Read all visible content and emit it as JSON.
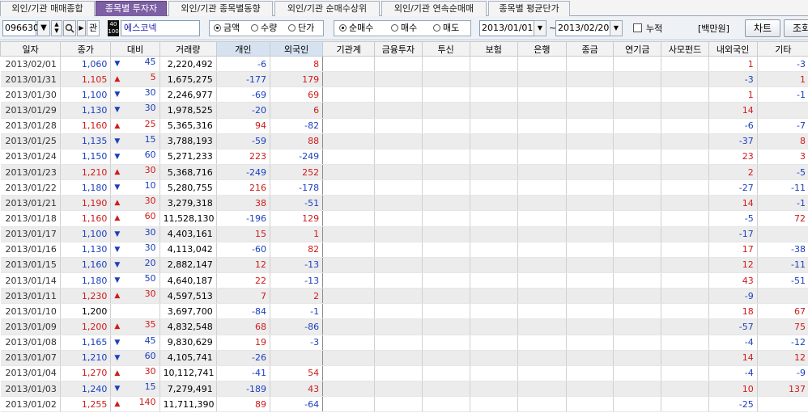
{
  "tabs": [
    {
      "label": "외인/기관 매매종합",
      "active": false
    },
    {
      "label": "종목별 투자자",
      "active": true
    },
    {
      "label": "외인/기관 종목별동향",
      "active": false
    },
    {
      "label": "외인/기관 순매수상위",
      "active": false
    },
    {
      "label": "외인/기관 연속순매매",
      "active": false
    },
    {
      "label": "종목별 평균단가",
      "active": false
    }
  ],
  "toolbar": {
    "stock_code": "096630",
    "kwan_label": "관",
    "logo_text": "40\n100",
    "stock_name": "에스코넥",
    "amount_radio": {
      "options": [
        "금액",
        "수량",
        "단가"
      ],
      "selected": "금액"
    },
    "trade_radio": {
      "options": [
        "순매수",
        "매수",
        "매도"
      ],
      "selected": "순매수"
    },
    "date_from": "2013/01/01",
    "date_to": "2013/02/20",
    "tilde": "~",
    "cumulative_label": "누적",
    "cumulative_checked": false,
    "unit_label": "[백만원]",
    "chart_button": "차트",
    "query_button": "조회"
  },
  "colors": {
    "active_tab": "#7d5fa4",
    "up": "#d11a1a",
    "down": "#1a3fbf",
    "header_highlight": "#d6e2f0"
  },
  "table": {
    "headers": [
      "일자",
      "종가",
      "대비",
      "거래량",
      "개인",
      "외국인",
      "기관계",
      "금융투자",
      "투신",
      "보험",
      "은행",
      "종금",
      "연기금",
      "사모펀드",
      "내외국인",
      "기타"
    ],
    "rows": [
      {
        "date": "2013/02/01",
        "close": "1,060",
        "dir": "down",
        "chg": "45",
        "vol": "2,220,492",
        "ind": "-6",
        "frg": "8",
        "inst": "",
        "fin": "",
        "tr": "",
        "ins": "",
        "bank": "",
        "jong": "",
        "pens": "",
        "pe": "",
        "dom": "1",
        "etc": "-3"
      },
      {
        "date": "2013/01/31",
        "close": "1,105",
        "dir": "up",
        "chg": "5",
        "vol": "1,675,275",
        "ind": "-177",
        "frg": "179",
        "inst": "",
        "fin": "",
        "tr": "",
        "ins": "",
        "bank": "",
        "jong": "",
        "pens": "",
        "pe": "",
        "dom": "-3",
        "etc": "1"
      },
      {
        "date": "2013/01/30",
        "close": "1,100",
        "dir": "down",
        "chg": "30",
        "vol": "2,246,977",
        "ind": "-69",
        "frg": "69",
        "inst": "",
        "fin": "",
        "tr": "",
        "ins": "",
        "bank": "",
        "jong": "",
        "pens": "",
        "pe": "",
        "dom": "1",
        "etc": "-1"
      },
      {
        "date": "2013/01/29",
        "close": "1,130",
        "dir": "down",
        "chg": "30",
        "vol": "1,978,525",
        "ind": "-20",
        "frg": "6",
        "inst": "",
        "fin": "",
        "tr": "",
        "ins": "",
        "bank": "",
        "jong": "",
        "pens": "",
        "pe": "",
        "dom": "14",
        "etc": ""
      },
      {
        "date": "2013/01/28",
        "close": "1,160",
        "dir": "up",
        "chg": "25",
        "vol": "5,365,316",
        "ind": "94",
        "frg": "-82",
        "inst": "",
        "fin": "",
        "tr": "",
        "ins": "",
        "bank": "",
        "jong": "",
        "pens": "",
        "pe": "",
        "dom": "-6",
        "etc": "-7"
      },
      {
        "date": "2013/01/25",
        "close": "1,135",
        "dir": "down",
        "chg": "15",
        "vol": "3,788,193",
        "ind": "-59",
        "frg": "88",
        "inst": "",
        "fin": "",
        "tr": "",
        "ins": "",
        "bank": "",
        "jong": "",
        "pens": "",
        "pe": "",
        "dom": "-37",
        "etc": "8"
      },
      {
        "date": "2013/01/24",
        "close": "1,150",
        "dir": "down",
        "chg": "60",
        "vol": "5,271,233",
        "ind": "223",
        "frg": "-249",
        "inst": "",
        "fin": "",
        "tr": "",
        "ins": "",
        "bank": "",
        "jong": "",
        "pens": "",
        "pe": "",
        "dom": "23",
        "etc": "3"
      },
      {
        "date": "2013/01/23",
        "close": "1,210",
        "dir": "up",
        "chg": "30",
        "vol": "5,368,716",
        "ind": "-249",
        "frg": "252",
        "inst": "",
        "fin": "",
        "tr": "",
        "ins": "",
        "bank": "",
        "jong": "",
        "pens": "",
        "pe": "",
        "dom": "2",
        "etc": "-5"
      },
      {
        "date": "2013/01/22",
        "close": "1,180",
        "dir": "down",
        "chg": "10",
        "vol": "5,280,755",
        "ind": "216",
        "frg": "-178",
        "inst": "",
        "fin": "",
        "tr": "",
        "ins": "",
        "bank": "",
        "jong": "",
        "pens": "",
        "pe": "",
        "dom": "-27",
        "etc": "-11"
      },
      {
        "date": "2013/01/21",
        "close": "1,190",
        "dir": "up",
        "chg": "30",
        "vol": "3,279,318",
        "ind": "38",
        "frg": "-51",
        "inst": "",
        "fin": "",
        "tr": "",
        "ins": "",
        "bank": "",
        "jong": "",
        "pens": "",
        "pe": "",
        "dom": "14",
        "etc": "-1"
      },
      {
        "date": "2013/01/18",
        "close": "1,160",
        "dir": "up",
        "chg": "60",
        "vol": "11,528,130",
        "ind": "-196",
        "frg": "129",
        "inst": "",
        "fin": "",
        "tr": "",
        "ins": "",
        "bank": "",
        "jong": "",
        "pens": "",
        "pe": "",
        "dom": "-5",
        "etc": "72"
      },
      {
        "date": "2013/01/17",
        "close": "1,100",
        "dir": "down",
        "chg": "30",
        "vol": "4,403,161",
        "ind": "15",
        "frg": "1",
        "inst": "",
        "fin": "",
        "tr": "",
        "ins": "",
        "bank": "",
        "jong": "",
        "pens": "",
        "pe": "",
        "dom": "-17",
        "etc": ""
      },
      {
        "date": "2013/01/16",
        "close": "1,130",
        "dir": "down",
        "chg": "30",
        "vol": "4,113,042",
        "ind": "-60",
        "frg": "82",
        "inst": "",
        "fin": "",
        "tr": "",
        "ins": "",
        "bank": "",
        "jong": "",
        "pens": "",
        "pe": "",
        "dom": "17",
        "etc": "-38"
      },
      {
        "date": "2013/01/15",
        "close": "1,160",
        "dir": "down",
        "chg": "20",
        "vol": "2,882,147",
        "ind": "12",
        "frg": "-13",
        "inst": "",
        "fin": "",
        "tr": "",
        "ins": "",
        "bank": "",
        "jong": "",
        "pens": "",
        "pe": "",
        "dom": "12",
        "etc": "-11"
      },
      {
        "date": "2013/01/14",
        "close": "1,180",
        "dir": "down",
        "chg": "50",
        "vol": "4,640,187",
        "ind": "22",
        "frg": "-13",
        "inst": "",
        "fin": "",
        "tr": "",
        "ins": "",
        "bank": "",
        "jong": "",
        "pens": "",
        "pe": "",
        "dom": "43",
        "etc": "-51"
      },
      {
        "date": "2013/01/11",
        "close": "1,230",
        "dir": "up",
        "chg": "30",
        "vol": "4,597,513",
        "ind": "7",
        "frg": "2",
        "inst": "",
        "fin": "",
        "tr": "",
        "ins": "",
        "bank": "",
        "jong": "",
        "pens": "",
        "pe": "",
        "dom": "-9",
        "etc": ""
      },
      {
        "date": "2013/01/10",
        "close": "1,200",
        "dir": "flat",
        "chg": "",
        "vol": "3,697,700",
        "ind": "-84",
        "frg": "-1",
        "inst": "",
        "fin": "",
        "tr": "",
        "ins": "",
        "bank": "",
        "jong": "",
        "pens": "",
        "pe": "",
        "dom": "18",
        "etc": "67"
      },
      {
        "date": "2013/01/09",
        "close": "1,200",
        "dir": "up",
        "chg": "35",
        "vol": "4,832,548",
        "ind": "68",
        "frg": "-86",
        "inst": "",
        "fin": "",
        "tr": "",
        "ins": "",
        "bank": "",
        "jong": "",
        "pens": "",
        "pe": "",
        "dom": "-57",
        "etc": "75"
      },
      {
        "date": "2013/01/08",
        "close": "1,165",
        "dir": "down",
        "chg": "45",
        "vol": "9,830,629",
        "ind": "19",
        "frg": "-3",
        "inst": "",
        "fin": "",
        "tr": "",
        "ins": "",
        "bank": "",
        "jong": "",
        "pens": "",
        "pe": "",
        "dom": "-4",
        "etc": "-12"
      },
      {
        "date": "2013/01/07",
        "close": "1,210",
        "dir": "down",
        "chg": "60",
        "vol": "4,105,741",
        "ind": "-26",
        "frg": "",
        "inst": "",
        "fin": "",
        "tr": "",
        "ins": "",
        "bank": "",
        "jong": "",
        "pens": "",
        "pe": "",
        "dom": "14",
        "etc": "12"
      },
      {
        "date": "2013/01/04",
        "close": "1,270",
        "dir": "up",
        "chg": "30",
        "vol": "10,112,741",
        "ind": "-41",
        "frg": "54",
        "inst": "",
        "fin": "",
        "tr": "",
        "ins": "",
        "bank": "",
        "jong": "",
        "pens": "",
        "pe": "",
        "dom": "-4",
        "etc": "-9"
      },
      {
        "date": "2013/01/03",
        "close": "1,240",
        "dir": "down",
        "chg": "15",
        "vol": "7,279,491",
        "ind": "-189",
        "frg": "43",
        "inst": "",
        "fin": "",
        "tr": "",
        "ins": "",
        "bank": "",
        "jong": "",
        "pens": "",
        "pe": "",
        "dom": "10",
        "etc": "137"
      },
      {
        "date": "2013/01/02",
        "close": "1,255",
        "dir": "up",
        "chg": "140",
        "vol": "11,711,390",
        "ind": "89",
        "frg": "-64",
        "inst": "",
        "fin": "",
        "tr": "",
        "ins": "",
        "bank": "",
        "jong": "",
        "pens": "",
        "pe": "",
        "dom": "-25",
        "etc": ""
      }
    ]
  }
}
